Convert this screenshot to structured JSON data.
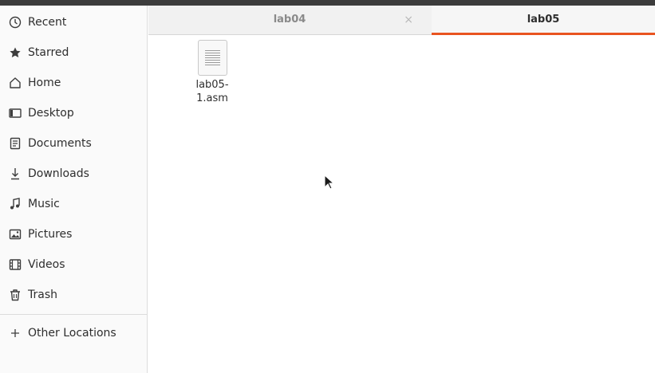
{
  "sidebar": {
    "items": [
      {
        "label": "Recent",
        "icon": "clock-icon"
      },
      {
        "label": "Starred",
        "icon": "star-icon"
      },
      {
        "label": "Home",
        "icon": "home-icon"
      },
      {
        "label": "Desktop",
        "icon": "desktop-icon"
      },
      {
        "label": "Documents",
        "icon": "document-icon"
      },
      {
        "label": "Downloads",
        "icon": "download-icon"
      },
      {
        "label": "Music",
        "icon": "music-icon"
      },
      {
        "label": "Pictures",
        "icon": "pictures-icon"
      },
      {
        "label": "Videos",
        "icon": "videos-icon"
      },
      {
        "label": "Trash",
        "icon": "trash-icon"
      }
    ],
    "other_locations": {
      "label": "Other Locations",
      "icon": "plus-icon"
    }
  },
  "tabs": [
    {
      "label": "lab04",
      "active": false,
      "close_glyph": "×"
    },
    {
      "label": "lab05",
      "active": true
    }
  ],
  "files": [
    {
      "name": "lab05-1.asm",
      "icon": "text-file-icon"
    }
  ],
  "colors": {
    "accent": "#e95420"
  }
}
